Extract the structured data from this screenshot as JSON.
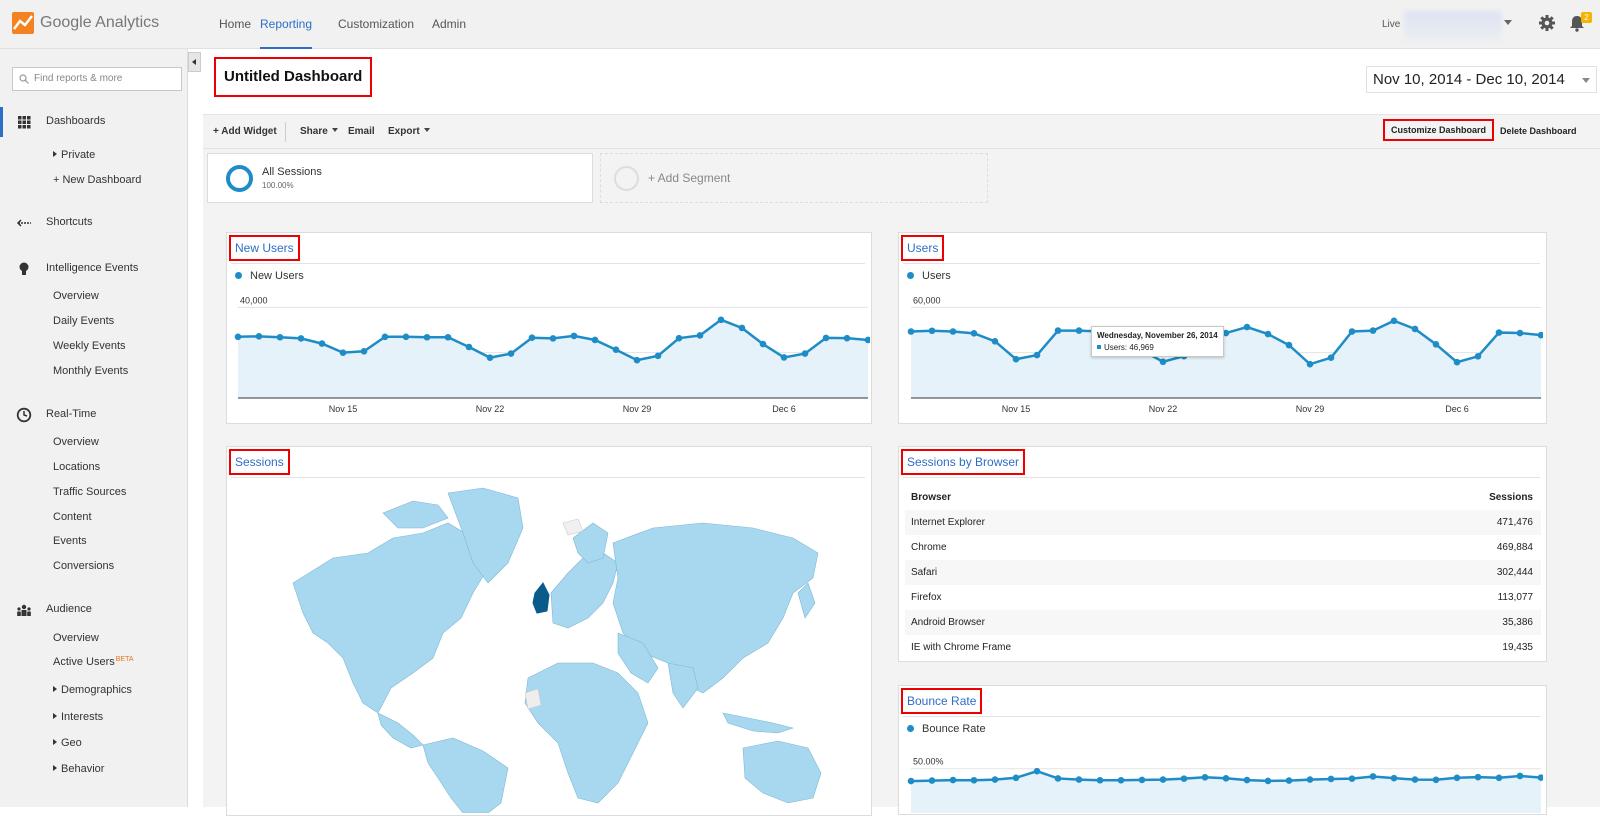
{
  "app": {
    "name": "Google Analytics"
  },
  "nav": {
    "tabs": [
      "Home",
      "Reporting",
      "Customization",
      "Admin"
    ],
    "active": "Reporting"
  },
  "header": {
    "live_label": "Live",
    "notification_count": "2"
  },
  "sidebar": {
    "search_placeholder": "Find reports & more",
    "dashboards": {
      "label": "Dashboards",
      "items": [
        "Private",
        "+ New Dashboard"
      ]
    },
    "shortcuts": {
      "label": "Shortcuts"
    },
    "intelligence": {
      "label": "Intelligence Events",
      "items": [
        "Overview",
        "Daily Events",
        "Weekly Events",
        "Monthly Events"
      ]
    },
    "realtime": {
      "label": "Real-Time",
      "items": [
        "Overview",
        "Locations",
        "Traffic Sources",
        "Content",
        "Events",
        "Conversions"
      ]
    },
    "audience": {
      "label": "Audience",
      "items": [
        "Overview",
        "Active Users",
        "Demographics",
        "Interests",
        "Geo",
        "Behavior"
      ],
      "beta": "BETA"
    }
  },
  "dashboard": {
    "title": "Untitled Dashboard",
    "date_range": "Nov 10, 2014 - Dec 10, 2014",
    "toolbar": {
      "add_widget": "+ Add Widget",
      "share": "Share",
      "email": "Email",
      "export": "Export",
      "customize": "Customize Dashboard",
      "delete": "Delete Dashboard"
    },
    "segments": {
      "all_name": "All Sessions",
      "all_pct": "100.00%",
      "add": "+ Add Segment"
    }
  },
  "widgets": {
    "new_users": {
      "title": "New Users",
      "legend": "New Users",
      "ytick": [
        "40,000",
        "20,000"
      ],
      "xticks": [
        "Nov 15",
        "Nov 22",
        "Nov 29",
        "Dec 6"
      ]
    },
    "users": {
      "title": "Users",
      "legend": "Users",
      "ytick": [
        "60,000",
        "30,000"
      ],
      "xticks": [
        "Nov 15",
        "Nov 22",
        "Nov 29",
        "Dec 6"
      ],
      "tooltip_date": "Wednesday, November 26, 2014",
      "tooltip_value": "Users: 46,969"
    },
    "sessions": {
      "title": "Sessions"
    },
    "browser": {
      "title": "Sessions by Browser",
      "col_browser": "Browser",
      "col_sessions": "Sessions",
      "rows": [
        {
          "name": "Internet Explorer",
          "value": "471,476"
        },
        {
          "name": "Chrome",
          "value": "469,884"
        },
        {
          "name": "Safari",
          "value": "302,444"
        },
        {
          "name": "Firefox",
          "value": "113,077"
        },
        {
          "name": "Android Browser",
          "value": "35,386"
        },
        {
          "name": "IE with Chrome Frame",
          "value": "19,435"
        }
      ]
    },
    "bounce": {
      "title": "Bounce Rate",
      "legend": "Bounce Rate",
      "ytick": "50.00%"
    }
  },
  "chart_data": [
    {
      "type": "area",
      "title": "New Users",
      "x": [
        "Nov 10",
        "Nov 11",
        "Nov 12",
        "Nov 13",
        "Nov 14",
        "Nov 15",
        "Nov 16",
        "Nov 17",
        "Nov 18",
        "Nov 19",
        "Nov 20",
        "Nov 21",
        "Nov 22",
        "Nov 23",
        "Nov 24",
        "Nov 25",
        "Nov 26",
        "Nov 27",
        "Nov 28",
        "Nov 29",
        "Nov 30",
        "Dec 1",
        "Dec 2",
        "Dec 3",
        "Dec 4",
        "Dec 5",
        "Dec 6",
        "Dec 7",
        "Dec 8",
        "Dec 9",
        "Dec 10"
      ],
      "series": [
        {
          "name": "New Users",
          "values": [
            27000,
            27200,
            26800,
            26300,
            24000,
            20000,
            20600,
            27000,
            27000,
            26800,
            26800,
            22500,
            17800,
            19600,
            26600,
            26300,
            27400,
            25600,
            21300,
            16700,
            18600,
            26400,
            27600,
            34500,
            30900,
            23800,
            17900,
            19600,
            26500,
            26400,
            25600
          ]
        }
      ],
      "ylim": [
        0,
        45000
      ]
    },
    {
      "type": "area",
      "title": "Users",
      "x": [
        "Nov 10",
        "Nov 11",
        "Nov 12",
        "Nov 13",
        "Nov 14",
        "Nov 15",
        "Nov 16",
        "Nov 17",
        "Nov 18",
        "Nov 19",
        "Nov 20",
        "Nov 21",
        "Nov 22",
        "Nov 23",
        "Nov 24",
        "Nov 25",
        "Nov 26",
        "Nov 27",
        "Nov 28",
        "Nov 29",
        "Nov 30",
        "Dec 1",
        "Dec 2",
        "Dec 3",
        "Dec 4",
        "Dec 5",
        "Dec 6",
        "Dec 7",
        "Dec 8",
        "Dec 9",
        "Dec 10"
      ],
      "series": [
        {
          "name": "Users",
          "values": [
            44000,
            44500,
            44000,
            42800,
            37500,
            25700,
            28400,
            44600,
            44600,
            44000,
            43700,
            31500,
            24000,
            27700,
            43300,
            43000,
            46969,
            42300,
            35000,
            22400,
            26700,
            44000,
            44600,
            51100,
            45700,
            35500,
            23700,
            27600,
            43300,
            43000,
            41600
          ]
        }
      ],
      "ylim": [
        0,
        67500
      ]
    },
    {
      "type": "area",
      "title": "Bounce Rate",
      "x": [
        "Nov 10",
        "Nov 11",
        "Nov 12",
        "Nov 13",
        "Nov 14",
        "Nov 15",
        "Nov 16",
        "Nov 17",
        "Nov 18",
        "Nov 19",
        "Nov 20",
        "Nov 21",
        "Nov 22",
        "Nov 23",
        "Nov 24",
        "Nov 25",
        "Nov 26",
        "Nov 27",
        "Nov 28",
        "Nov 29",
        "Nov 30",
        "Dec 1",
        "Dec 2",
        "Dec 3",
        "Dec 4",
        "Dec 5",
        "Dec 6",
        "Dec 7",
        "Dec 8",
        "Dec 9",
        "Dec 10"
      ],
      "series": [
        {
          "name": "Bounce Rate",
          "values": [
            42.5,
            42.8,
            43.1,
            43.0,
            43.4,
            44.5,
            48.5,
            44.1,
            43.4,
            43.0,
            43.0,
            43.2,
            43.4,
            44.0,
            44.8,
            44.2,
            43.1,
            42.6,
            42.8,
            43.4,
            43.8,
            44.0,
            45.3,
            44.3,
            43.4,
            43.3,
            44.5,
            44.9,
            44.5,
            45.6,
            44.6
          ]
        }
      ],
      "ylim": [
        0,
        62
      ]
    }
  ]
}
